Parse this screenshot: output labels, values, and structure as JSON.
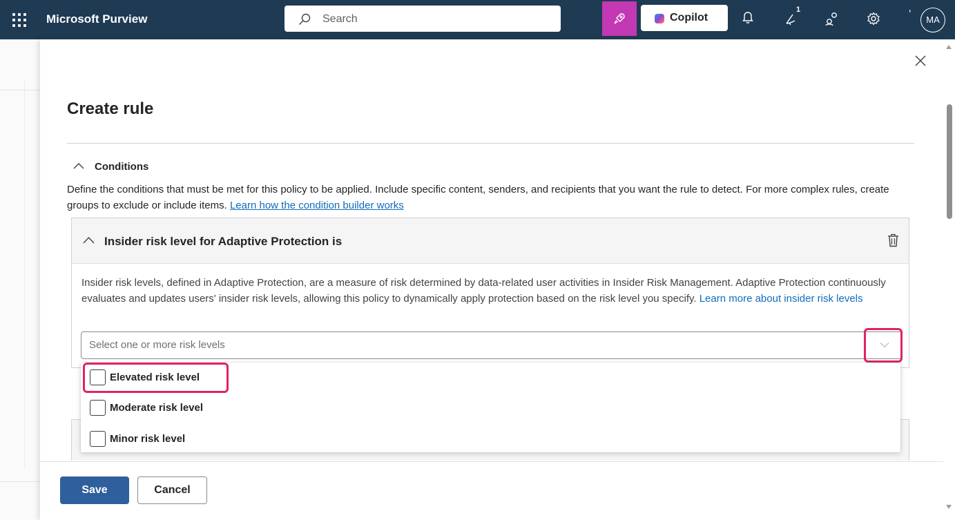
{
  "app": {
    "title": "Microsoft Purview"
  },
  "topbar": {
    "search_placeholder": "Search",
    "copilot_label": "Copilot",
    "notification_count": "1",
    "avatar_initials": "MA",
    "icons": [
      "app-launcher-icon",
      "search-icon",
      "rocket-icon",
      "copilot-icon",
      "bell-icon",
      "megaphone-icon",
      "community-icon",
      "settings-icon"
    ]
  },
  "panel": {
    "title": "Create rule",
    "conditions": {
      "label": "Conditions",
      "description": "Define the conditions that must be met for this policy to be applied. Include specific content, senders, and recipients that you want the rule to detect. For more complex rules, create groups to exclude or include items.",
      "link": "Learn how the condition builder works"
    },
    "condition_card": {
      "title": "Insider risk level for Adaptive Protection is",
      "description": "Insider risk levels, defined in Adaptive Protection, are a measure of risk determined by data-related user activities in Insider Risk Management. Adaptive Protection continuously evaluates and updates users' insider risk levels, allowing this policy to dynamically apply protection based on the risk level you specify.",
      "link": "Learn more about insider risk levels",
      "dropdown_placeholder": "Select one or more risk levels",
      "options": [
        {
          "label": "Elevated risk level",
          "checked": false
        },
        {
          "label": "Moderate risk level",
          "checked": false
        },
        {
          "label": "Minor risk level",
          "checked": false
        }
      ]
    },
    "footer": {
      "save_label": "Save",
      "cancel_label": "Cancel"
    }
  },
  "colors": {
    "topbar_bg": "#1f3a53",
    "accent_pink": "#c239b3",
    "highlight": "#e0245e",
    "primary_button": "#2f5f9c",
    "link": "#0f6cbd"
  }
}
